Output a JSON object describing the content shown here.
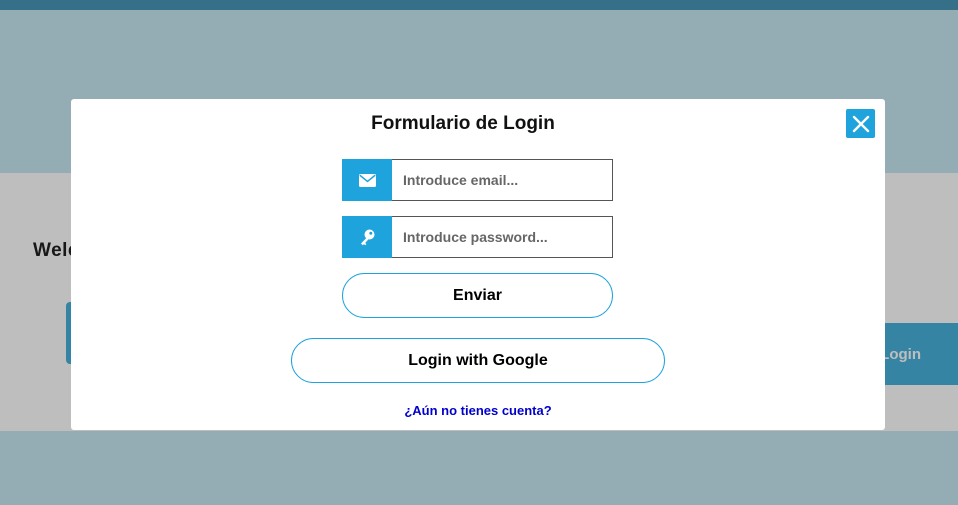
{
  "background": {
    "welcome_text": "Welc",
    "login_button_label": "Login"
  },
  "modal": {
    "title": "Formulario de Login",
    "email": {
      "placeholder": "Introduce email...",
      "icon": "envelope-icon"
    },
    "password": {
      "placeholder": "Introduce password...",
      "icon": "key-icon"
    },
    "submit_label": "Enviar",
    "google_label": "Login with Google",
    "register_link": "¿Aún no tienes cuenta?",
    "close_icon": "close-icon"
  },
  "colors": {
    "accent": "#1ea3dd",
    "link": "#0000cc",
    "topbar": "#2e86ad"
  }
}
